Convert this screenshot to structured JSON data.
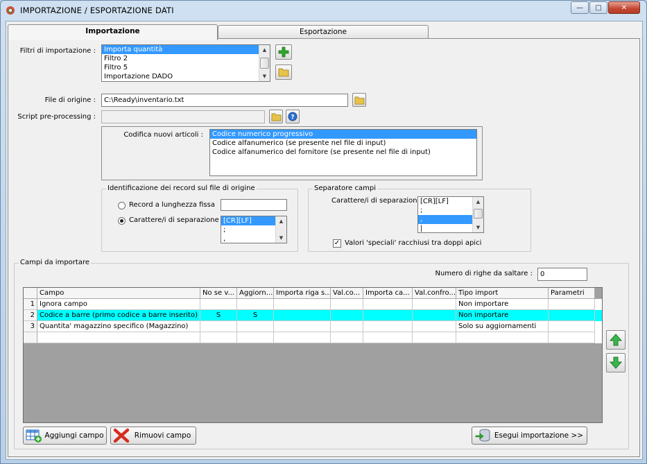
{
  "window": {
    "title": "IMPORTAZIONE / ESPORTAZIONE DATI",
    "controls": {
      "minimize": "—",
      "maximize": "□",
      "close": "✕"
    }
  },
  "tabs": [
    {
      "label": "Importazione",
      "active": true
    },
    {
      "label": "Esportazione",
      "active": false
    }
  ],
  "filters": {
    "label": "Filtri di importazione :",
    "items": [
      "Importa quantità",
      "Filtro 2",
      "Filtro 5",
      "Importazione DADO"
    ],
    "selected_index": 0
  },
  "source_file": {
    "label": "File di origine :",
    "value": "C:\\Ready\\inventario.txt"
  },
  "script": {
    "label": "Script pre-processing :",
    "value": ""
  },
  "codifica": {
    "label": "Codifica nuovi articoli :",
    "options": [
      "Codice numerico progressivo",
      "Codice alfanumerico (se presente nel file di input)",
      "Codice alfanumerico del fornitore (se presente nel file di input)"
    ],
    "selected_index": 0
  },
  "record_id": {
    "group_title": "Identificazione dei record sul file di origine",
    "fixed_length_label": "Record a lunghezza fissa",
    "fixed_length_value": "",
    "separator_label": "Carattere/i di separazione",
    "separator_items": [
      "[CR][LF]",
      ";",
      ","
    ],
    "selected": "separator"
  },
  "field_sep": {
    "group_title": "Separatore campi",
    "label": "Carattere/i di separazione",
    "items": [
      "[CR][LF]",
      ";",
      ",",
      "|"
    ],
    "selected_index": 2,
    "quotes_label": "Valori 'speciali' racchiusi tra doppi apici",
    "quotes_checked": true,
    "check_mark": "✓"
  },
  "campi": {
    "group_title": "Campi da importare",
    "skip_rows_label": "Numero di righe da saltare :",
    "skip_rows_value": "0",
    "columns": [
      "Campo",
      "No se v...",
      "Aggiorn...",
      "Importa riga s...",
      "Val.co...",
      "Importa ca...",
      "Val.confro...",
      "Tipo import",
      "Parametri"
    ],
    "rows": [
      {
        "num": "1",
        "campo": "Ignora campo",
        "nosev": "",
        "aggiorn": "",
        "importa_riga": "",
        "valco": "",
        "importa_ca": "",
        "valconfro": "",
        "tipo": "Non importare",
        "parametri": ""
      },
      {
        "num": "2",
        "campo": "Codice a barre (primo codice a barre inserito)",
        "nosev": "S",
        "aggiorn": "S",
        "importa_riga": "",
        "valco": "",
        "importa_ca": "",
        "valconfro": "",
        "tipo": "Non importare",
        "parametri": ""
      },
      {
        "num": "3",
        "campo": "Quantita' magazzino specifico (Magazzino)",
        "nosev": "",
        "aggiorn": "",
        "importa_riga": "",
        "valco": "",
        "importa_ca": "",
        "valconfro": "",
        "tipo": "Solo su aggiornamenti",
        "parametri": ""
      }
    ],
    "highlight_color": "#00ffff"
  },
  "buttons": {
    "add_field": "Aggiungi campo",
    "remove_field": "Rimuovi campo",
    "run_import": "Esegui importazione >>"
  },
  "colors": {
    "selection": "#3399ff",
    "add_icon": "#2fa82a",
    "folder_icon": "#e8c34a",
    "remove_icon": "#d62b1f"
  }
}
